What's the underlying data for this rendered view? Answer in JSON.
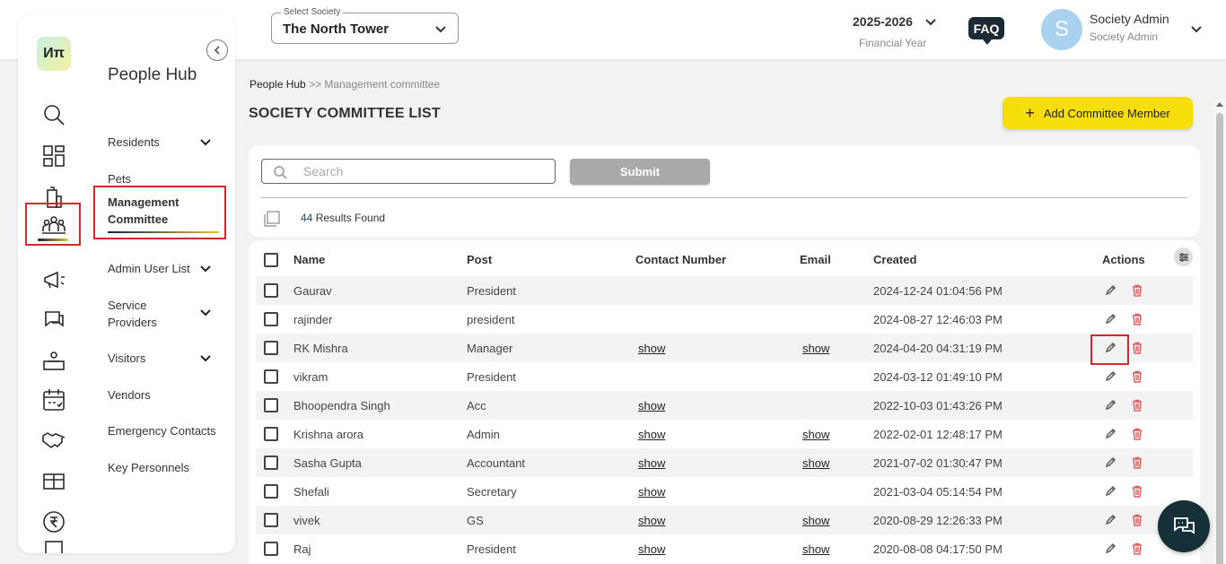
{
  "header": {
    "society_select_label": "Select Society",
    "society_value": "The North Tower",
    "financial_year": "2025-2026",
    "financial_year_label": "Financial Year",
    "faq_label": "FAQ",
    "avatar_initial": "S",
    "user_name": "Society Admin",
    "user_role": "Society Admin"
  },
  "logo": "Иπ",
  "sidebar": {
    "title": "People Hub",
    "rail_icons": [
      "search-icon",
      "dashboard-icon",
      "building-icon",
      "people-icon",
      "megaphone-icon",
      "chat-icon",
      "helpdesk-icon",
      "calendar-icon",
      "handshake-icon",
      "package-icon",
      "rupee-icon",
      "more-icon"
    ],
    "items": [
      {
        "label": "Residents",
        "has_chevron": true
      },
      {
        "label": "Pets",
        "has_chevron": false
      },
      {
        "label": "Management Committee",
        "has_chevron": false,
        "active": true
      },
      {
        "label": "Admin User List",
        "has_chevron": true
      },
      {
        "label": "Service Providers",
        "has_chevron": true
      },
      {
        "label": "Visitors",
        "has_chevron": true
      },
      {
        "label": "Vendors",
        "has_chevron": false
      },
      {
        "label": "Emergency Contacts",
        "has_chevron": false
      },
      {
        "label": "Key Personnels",
        "has_chevron": false
      }
    ]
  },
  "breadcrumb": {
    "root": "People Hub",
    "separator": ">>",
    "current": "Management committee"
  },
  "page": {
    "title": "SOCIETY COMMITTEE LIST",
    "add_button_label": "Add Committee Member"
  },
  "search": {
    "placeholder": "Search",
    "value": "",
    "submit_label": "Submit"
  },
  "results": {
    "count": "44",
    "label": "Results Found"
  },
  "table": {
    "columns": [
      "Name",
      "Post",
      "Contact Number",
      "Email",
      "Created",
      "Actions"
    ],
    "rows": [
      {
        "name": "Gaurav",
        "post": "President",
        "contact": "",
        "email": "",
        "created": "2024-12-24 01:04:56 PM"
      },
      {
        "name": "rajinder",
        "post": "president",
        "contact": "",
        "email": "",
        "created": "2024-08-27 12:46:03 PM"
      },
      {
        "name": "RK Mishra",
        "post": "Manager",
        "contact": "show",
        "email": "show",
        "created": "2024-04-20 04:31:19 PM"
      },
      {
        "name": "vikram",
        "post": "President",
        "contact": "",
        "email": "",
        "created": "2024-03-12 01:49:10 PM"
      },
      {
        "name": "Bhoopendra Singh",
        "post": "Acc",
        "contact": "show",
        "email": "",
        "created": "2022-10-03 01:43:26 PM"
      },
      {
        "name": "Krishna arora",
        "post": "Admin",
        "contact": "show",
        "email": "show",
        "created": "2022-02-01 12:48:17 PM"
      },
      {
        "name": "Sasha Gupta",
        "post": "Accountant",
        "contact": "show",
        "email": "show",
        "created": "2021-07-02 01:30:47 PM"
      },
      {
        "name": "Shefali",
        "post": "Secretary",
        "contact": "show",
        "email": "",
        "created": "2021-03-04 05:14:54 PM"
      },
      {
        "name": "vivek",
        "post": "GS",
        "contact": "show",
        "email": "show",
        "created": "2020-08-29 12:26:33 PM"
      },
      {
        "name": "Raj",
        "post": "President",
        "contact": "show",
        "email": "show",
        "created": "2020-08-08 04:17:50 PM"
      }
    ]
  },
  "colors": {
    "accent_yellow": "#f7dd0a",
    "highlight_red": "#d7262c",
    "dark_navy": "#16303a",
    "delete_red": "#e35c5c"
  }
}
